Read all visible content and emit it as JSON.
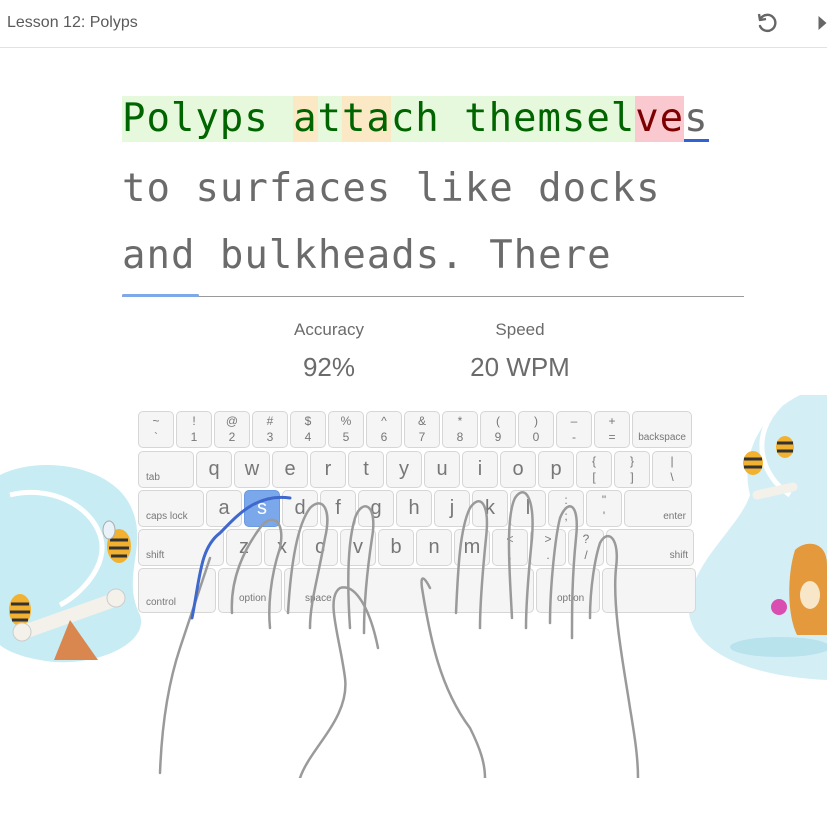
{
  "header": {
    "title": "Lesson 12: Polyps"
  },
  "typing": {
    "lines": [
      {
        "chars": [
          {
            "t": "P",
            "s": "ok"
          },
          {
            "t": "o",
            "s": "ok"
          },
          {
            "t": "l",
            "s": "ok"
          },
          {
            "t": "y",
            "s": "ok"
          },
          {
            "t": "p",
            "s": "ok"
          },
          {
            "t": "s",
            "s": "ok"
          },
          {
            "t": " ",
            "s": "ok"
          },
          {
            "t": "a",
            "s": "warn"
          },
          {
            "t": "t",
            "s": "ok"
          },
          {
            "t": "t",
            "s": "warn"
          },
          {
            "t": "a",
            "s": "warn"
          },
          {
            "t": "c",
            "s": "ok"
          },
          {
            "t": "h",
            "s": "ok"
          },
          {
            "t": " ",
            "s": "ok"
          },
          {
            "t": "t",
            "s": "ok"
          },
          {
            "t": "h",
            "s": "ok"
          },
          {
            "t": "e",
            "s": "ok"
          },
          {
            "t": "m",
            "s": "ok"
          },
          {
            "t": "s",
            "s": "ok"
          },
          {
            "t": "e",
            "s": "ok"
          },
          {
            "t": "l",
            "s": "ok"
          },
          {
            "t": "v",
            "s": "err"
          },
          {
            "t": "e",
            "s": "err"
          },
          {
            "t": "s",
            "s": "cur"
          }
        ]
      },
      {
        "text": "to surfaces like docks"
      },
      {
        "text": "and bulkheads. There"
      }
    ],
    "progress_fraction": 0.124
  },
  "stats": {
    "accuracy_label": "Accuracy",
    "accuracy_value": "92%",
    "speed_label": "Speed",
    "speed_value": "20 WPM"
  },
  "keyboard": {
    "active_key": "s",
    "rows": [
      [
        {
          "top": "~",
          "bot": "`"
        },
        {
          "top": "!",
          "bot": "1"
        },
        {
          "top": "@",
          "bot": "2"
        },
        {
          "top": "#",
          "bot": "3"
        },
        {
          "top": "$",
          "bot": "4"
        },
        {
          "top": "%",
          "bot": "5"
        },
        {
          "top": "^",
          "bot": "6"
        },
        {
          "top": "&",
          "bot": "7"
        },
        {
          "top": "*",
          "bot": "8"
        },
        {
          "top": "(",
          "bot": "9"
        },
        {
          "top": ")",
          "bot": "0"
        },
        {
          "top": "–",
          "bot": "-"
        },
        {
          "top": "+",
          "bot": "="
        },
        {
          "mod": "backspace"
        }
      ],
      [
        {
          "mod": "tab"
        },
        {
          "big": "q"
        },
        {
          "big": "w"
        },
        {
          "big": "e"
        },
        {
          "big": "r"
        },
        {
          "big": "t"
        },
        {
          "big": "y"
        },
        {
          "big": "u"
        },
        {
          "big": "i"
        },
        {
          "big": "o"
        },
        {
          "big": "p"
        },
        {
          "top": "{",
          "bot": "["
        },
        {
          "top": "}",
          "bot": "]"
        },
        {
          "top": "|",
          "bot": "\\"
        }
      ],
      [
        {
          "mod": "caps lock"
        },
        {
          "big": "a"
        },
        {
          "big": "s"
        },
        {
          "big": "d"
        },
        {
          "big": "f"
        },
        {
          "big": "g"
        },
        {
          "big": "h"
        },
        {
          "big": "j"
        },
        {
          "big": "k"
        },
        {
          "big": "l"
        },
        {
          "top": ":",
          "bot": ";"
        },
        {
          "top": "\"",
          "bot": "'"
        },
        {
          "mod": "enter"
        }
      ],
      [
        {
          "mod": "shift"
        },
        {
          "big": "z"
        },
        {
          "big": "x"
        },
        {
          "big": "c"
        },
        {
          "big": "v"
        },
        {
          "big": "b"
        },
        {
          "big": "n"
        },
        {
          "big": "m"
        },
        {
          "top": "<",
          "bot": ","
        },
        {
          "top": ">",
          "bot": "."
        },
        {
          "top": "?",
          "bot": "/"
        },
        {
          "mod": "shift"
        }
      ],
      [
        {
          "mod": "control"
        },
        {
          "mod": "option"
        },
        {
          "mod": "space"
        },
        {
          "mod": "option"
        },
        {
          "mod": ""
        }
      ]
    ]
  },
  "colors": {
    "accent": "#2f62d2",
    "correct_bg": "#e6f9dc",
    "warn_bg": "#fbe8c4",
    "error_bg": "#fac8cf",
    "active_key": "#7aa8ea"
  },
  "icons": {
    "restart": "restart-icon",
    "skip": "skip-next-icon"
  }
}
